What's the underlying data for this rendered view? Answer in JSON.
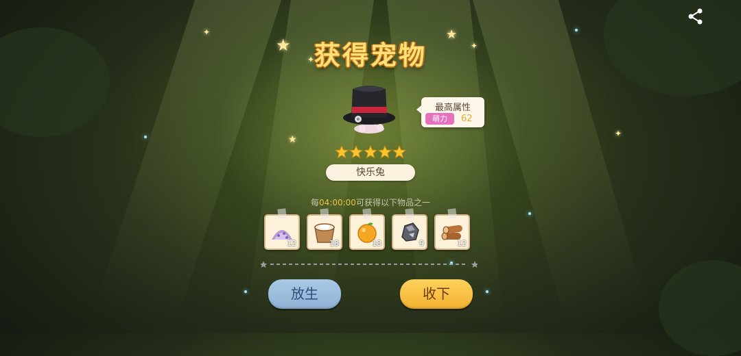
{
  "dialog": {
    "title": "获得宠物",
    "pet": {
      "name": "快乐兔",
      "stars": 5
    },
    "top_attribute": {
      "label": "最高属性",
      "tag": "萌力",
      "value": "62"
    },
    "production": {
      "prefix": "每",
      "time": "04:00:00",
      "suffix": "可获得以下物品之一"
    },
    "items": [
      {
        "icon": "purple-sugar-icon",
        "qty": "12"
      },
      {
        "icon": "flour-bucket-icon",
        "qty": "18"
      },
      {
        "icon": "orange-fruit-icon",
        "qty": "18"
      },
      {
        "icon": "iron-ore-icon",
        "qty": "9"
      },
      {
        "icon": "wood-log-icon",
        "qty": "12"
      }
    ],
    "buttons": {
      "release": "放生",
      "keep": "收下"
    }
  },
  "colors": {
    "title": "#ffe178",
    "accent_orange": "#f5b231",
    "accent_blue": "#8fb3d6",
    "tag_pink": "#e672bd"
  }
}
